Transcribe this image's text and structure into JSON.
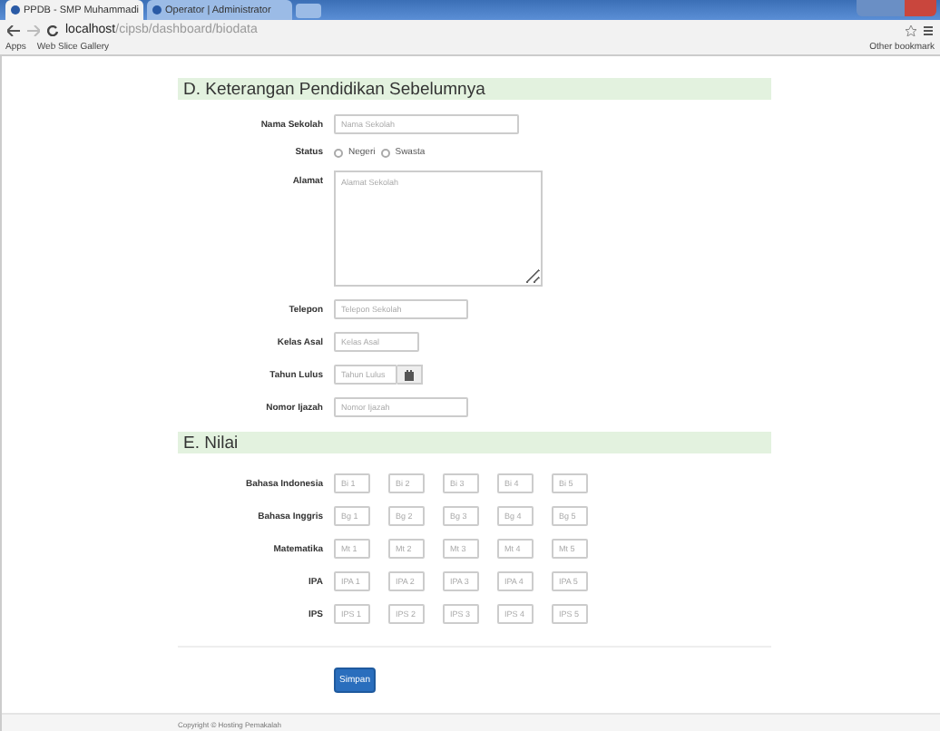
{
  "browser": {
    "tabs": [
      {
        "title": "PPDB - SMP Muhammadi",
        "selected": true
      },
      {
        "title": "Operator | Administrator",
        "selected": false
      }
    ],
    "address": {
      "host": "localhost",
      "path": "/cipsb/dashboard/biodata"
    },
    "bookmarks": [
      "Apps",
      "Web Slice Gallery"
    ],
    "other_bookmarks": "Other bookmark"
  },
  "sections": [
    {
      "title": "D. Keterangan Pendidikan Sebelumnya",
      "fields": [
        {
          "kind": "widetext",
          "label": "Nama Sekolah",
          "placeholder": "Nama Sekolah"
        },
        {
          "kind": "radio",
          "label": "Status",
          "options": [
            {
              "label": "Negeri",
              "selected": false
            },
            {
              "label": "Swasta",
              "selected": false
            }
          ]
        },
        {
          "kind": "textarea",
          "label": "Alamat",
          "placeholder": "Alamat Sekolah"
        },
        {
          "kind": "text",
          "label": "Telepon",
          "placeholder": "Telepon Sekolah"
        },
        {
          "kind": "shorttext",
          "label": "Kelas Asal",
          "placeholder": "Kelas Asal"
        },
        {
          "kind": "date",
          "label": "Tahun Lulus",
          "placeholder": "Tahun Lulus"
        },
        {
          "kind": "text",
          "label": "Nomor Ijazah",
          "placeholder": "Nomor Ijazah"
        }
      ]
    }
  ],
  "nilai": {
    "title": "E. Nilai",
    "rows": [
      {
        "label": "Bahasa Indonesia",
        "inputs": [
          {
            "placeholder": "Bi 1"
          },
          {
            "placeholder": "Bi 2"
          },
          {
            "placeholder": "Bi 3"
          },
          {
            "placeholder": "Bi 4"
          },
          {
            "placeholder": "Bi 5"
          }
        ]
      },
      {
        "label": "Bahasa Inggris",
        "inputs": [
          {
            "placeholder": "Bg 1"
          },
          {
            "placeholder": "Bg 2"
          },
          {
            "placeholder": "Bg 3"
          },
          {
            "placeholder": "Bg 4"
          },
          {
            "placeholder": "Bg 5"
          }
        ]
      },
      {
        "label": "Matematika",
        "inputs": [
          {
            "placeholder": "Mt 1"
          },
          {
            "placeholder": "Mt 2"
          },
          {
            "placeholder": "Mt 3"
          },
          {
            "placeholder": "Mt 4"
          },
          {
            "placeholder": "Mt 5"
          }
        ]
      },
      {
        "label": "IPA",
        "inputs": [
          {
            "placeholder": "IPA 1"
          },
          {
            "placeholder": "IPA 2"
          },
          {
            "placeholder": "IPA 3"
          },
          {
            "placeholder": "IPA 4"
          },
          {
            "placeholder": "IPA 5"
          }
        ]
      },
      {
        "label": "IPS",
        "inputs": [
          {
            "placeholder": "IPS 1"
          },
          {
            "placeholder": "IPS 2"
          },
          {
            "placeholder": "IPS 3"
          },
          {
            "placeholder": "IPS 4"
          },
          {
            "placeholder": "IPS 5"
          }
        ]
      }
    ]
  },
  "submit": "Simpan",
  "footer": "Copyright © Hosting Pemakalah"
}
